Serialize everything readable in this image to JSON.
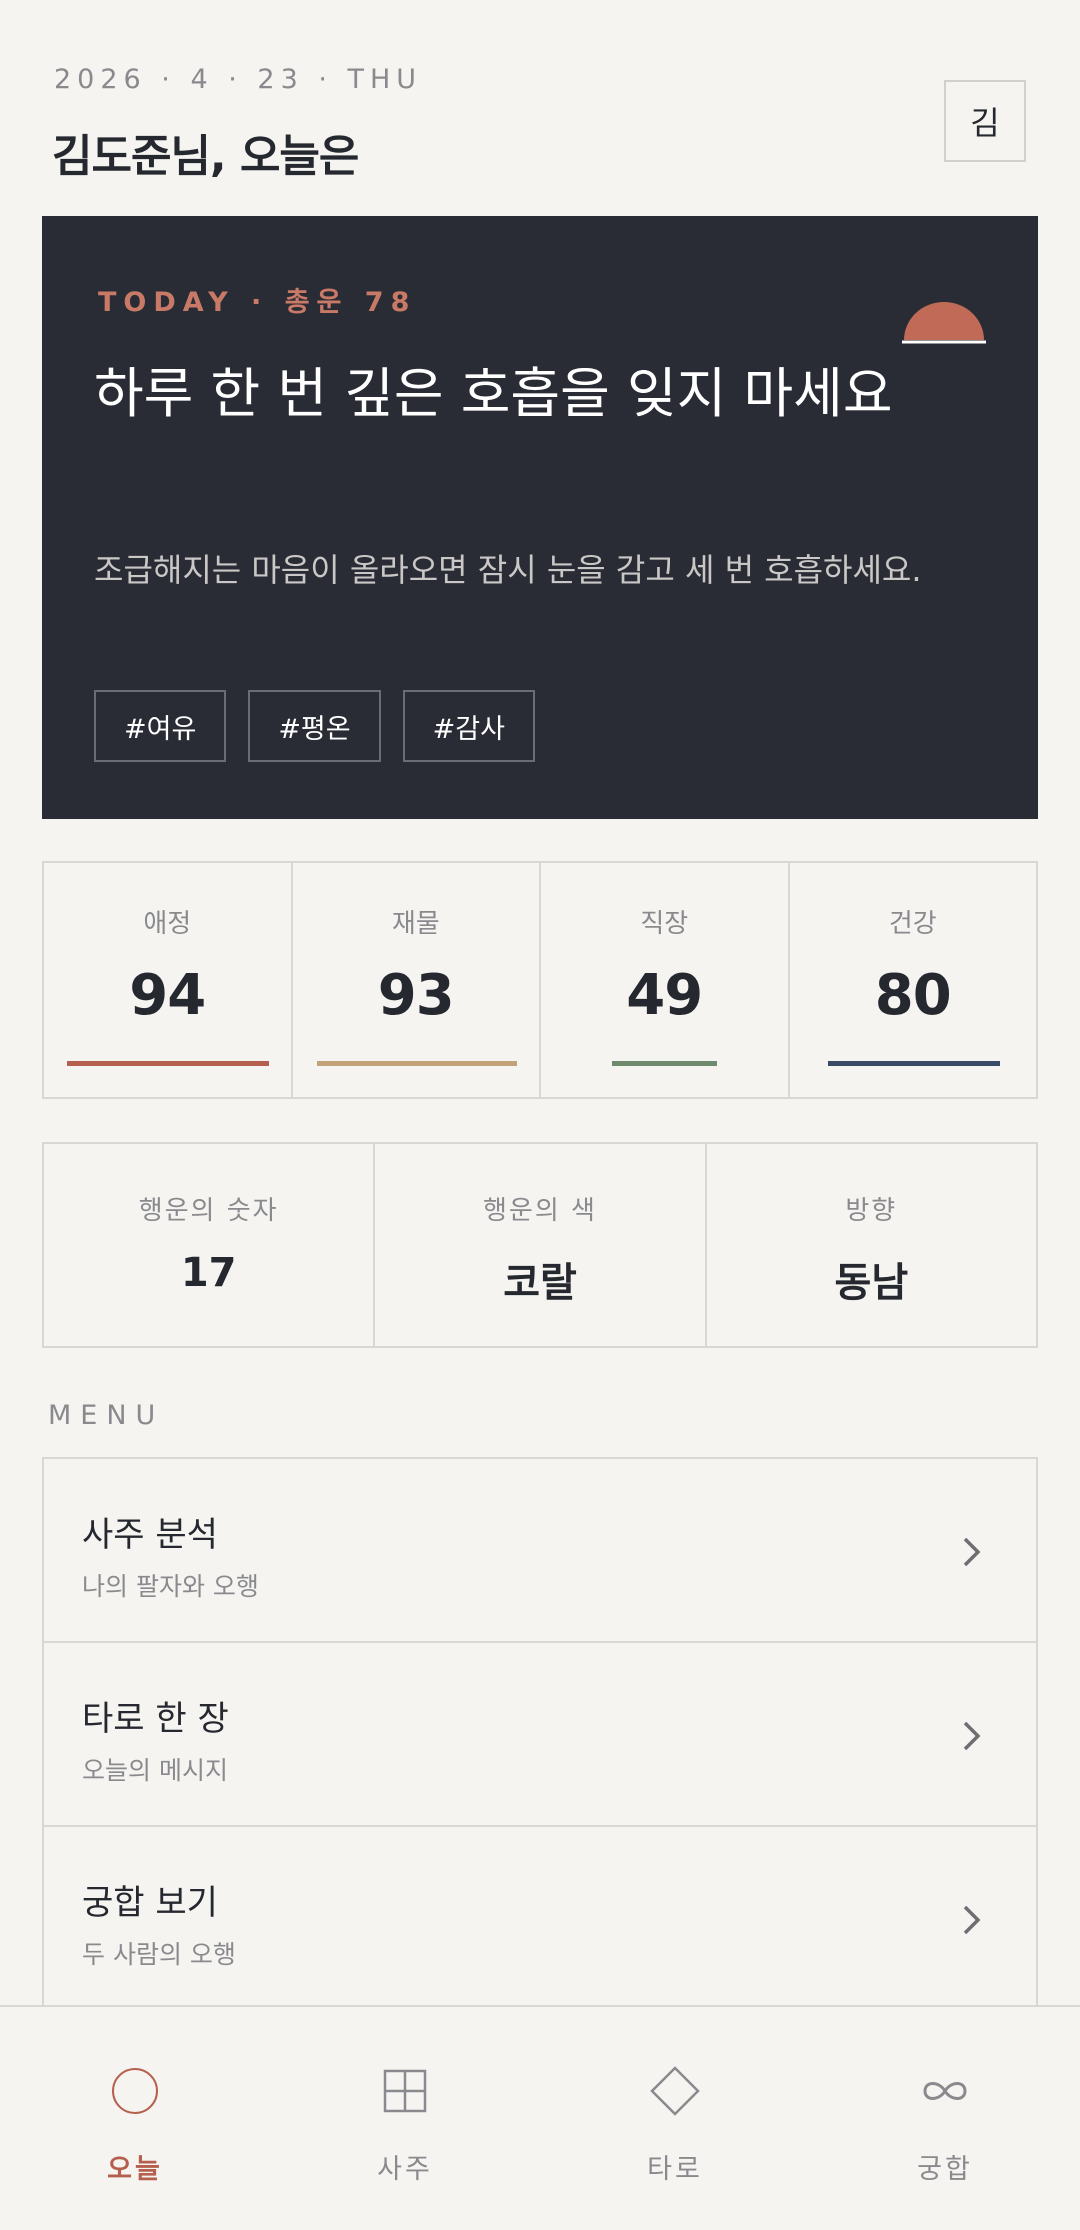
{
  "header": {
    "date": "2026 · 4 · 23 · THU",
    "greeting": "김도준님, 오늘은",
    "avatar": "김"
  },
  "hero": {
    "eyebrow": "TODAY · 총운 78",
    "title": "하루 한 번 깊은 호흡을 잊지 마세요",
    "description": "조급해지는 마음이 올라오면 잠시 눈을 감고 세 번 호흡하세요.",
    "tags": [
      "#여유",
      "#평온",
      "#감사"
    ],
    "sun_icon": "half-sun-icon",
    "accent_color": "#c06a57"
  },
  "scores": [
    {
      "label": "애정",
      "value": 94,
      "color": "#b5604e"
    },
    {
      "label": "재물",
      "value": 93,
      "color": "#c2a377"
    },
    {
      "label": "직장",
      "value": 49,
      "color": "#6f8a6c"
    },
    {
      "label": "건강",
      "value": 80,
      "color": "#3a4a66"
    }
  ],
  "lucky": [
    {
      "label": "행운의 숫자",
      "value": "17"
    },
    {
      "label": "행운의 색",
      "value": "코랄"
    },
    {
      "label": "방향",
      "value": "동남"
    }
  ],
  "menu": {
    "label": "MENU",
    "items": [
      {
        "title": "사주 분석",
        "subtitle": "나의 팔자와 오행",
        "icon": "chevron-right-icon"
      },
      {
        "title": "타로 한 장",
        "subtitle": "오늘의 메시지",
        "icon": "chevron-right-icon"
      },
      {
        "title": "궁합 보기",
        "subtitle": "두 사람의 오행",
        "icon": "chevron-right-icon"
      }
    ]
  },
  "tabs": [
    {
      "label": "오늘",
      "icon": "circle-icon",
      "active": true
    },
    {
      "label": "사주",
      "icon": "grid-icon",
      "active": false
    },
    {
      "label": "타로",
      "icon": "diamond-icon",
      "active": false
    },
    {
      "label": "궁합",
      "icon": "infinity-icon",
      "active": false
    }
  ],
  "colors": {
    "background": "#f5f4f1",
    "dark": "#2a2c35",
    "accent": "#b5604e",
    "muted": "#8a8a8e"
  }
}
